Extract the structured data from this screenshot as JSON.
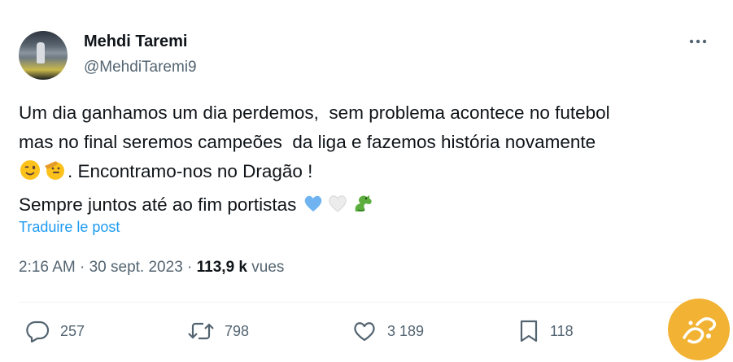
{
  "author": {
    "display_name": "Mehdi Taremi",
    "handle": "@MehdiTaremi9"
  },
  "tweet": {
    "line1": "Um dia ganhamos um dia perdemos,  sem problema acontece no futebol",
    "line2": "mas no final seremos campeões  da liga e fazemos história novamente",
    "line3_text": ". Encontramo-nos no Dragão !",
    "line4_text": "Sempre juntos até ao fim portistas ",
    "emojis": [
      "winking-face",
      "saluting-face",
      "light-blue-heart",
      "white-heart",
      "dragon"
    ]
  },
  "translate_label": "Traduire le post",
  "meta": {
    "time": "2:16 AM",
    "separator": " · ",
    "date": "30 sept. 2023",
    "views_count": "113,9 k",
    "views_label": " vues"
  },
  "actions": {
    "replies": "257",
    "reposts": "798",
    "likes": "3 189",
    "bookmarks": "118"
  },
  "colors": {
    "link": "#1d9bf0",
    "secondary_text": "#536471",
    "primary_text": "#0f1419",
    "watermark": "#f2b233"
  }
}
